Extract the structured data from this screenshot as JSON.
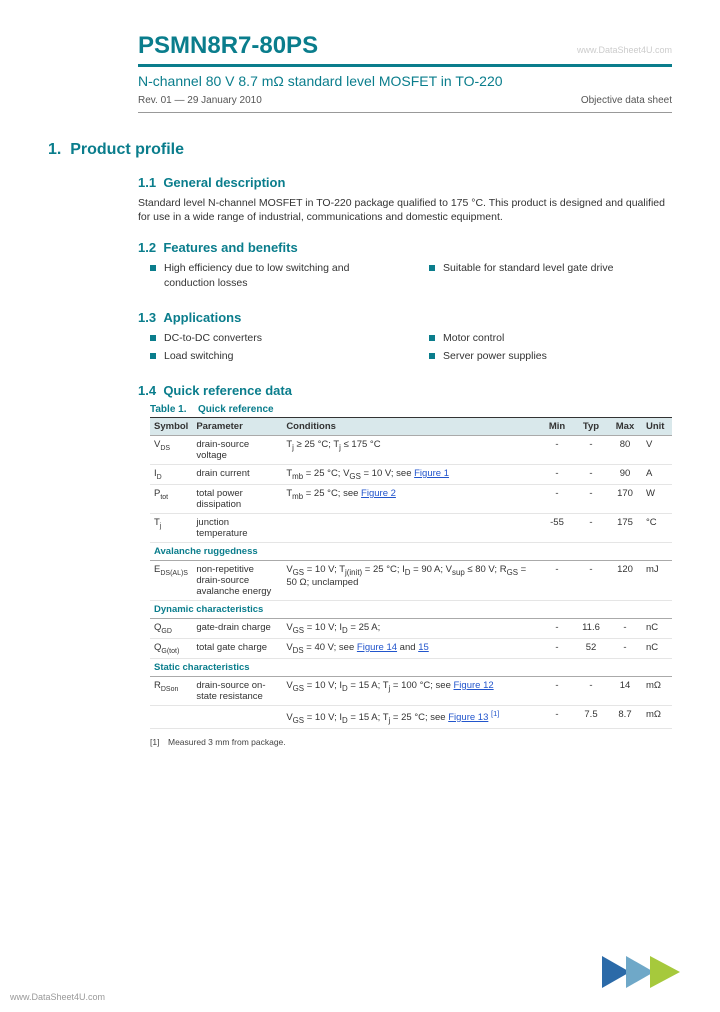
{
  "header": {
    "part_number": "PSMN8R7-80PS",
    "right_faint": "www.DataSheet4U.com",
    "subtitle": "N-channel 80 V 8.7 mΩ standard level MOSFET in TO-220",
    "rev": "Rev. 01 — 29 January 2010",
    "doc_type": "Objective data sheet"
  },
  "s1": {
    "num": "1.",
    "title": "Product profile",
    "s11": {
      "num": "1.1",
      "title": "General description",
      "text": "Standard level N-channel MOSFET in TO-220 package qualified to 175 °C. This product is designed and qualified for use in a wide range of industrial, communications and domestic equipment."
    },
    "s12": {
      "num": "1.2",
      "title": "Features and benefits",
      "left": [
        "High efficiency due to low switching and conduction losses"
      ],
      "right": [
        "Suitable for standard level gate drive"
      ]
    },
    "s13": {
      "num": "1.3",
      "title": "Applications",
      "left": [
        "DC-to-DC converters",
        "Load switching"
      ],
      "right": [
        "Motor control",
        "Server power supplies"
      ]
    },
    "s14": {
      "num": "1.4",
      "title": "Quick reference data"
    }
  },
  "table": {
    "caption_num": "Table 1.",
    "caption": "Quick reference",
    "headers": [
      "Symbol",
      "Parameter",
      "Conditions",
      "Min",
      "Typ",
      "Max",
      "Unit"
    ],
    "rows": [
      {
        "sym": "V<sub>DS</sub>",
        "par": "drain-source voltage",
        "cond": "T<sub>j</sub> ≥ 25 °C; T<sub>j</sub> ≤ 175 °C",
        "min": "-",
        "typ": "-",
        "max": "80",
        "unit": "V"
      },
      {
        "sym": "I<sub>D</sub>",
        "par": "drain current",
        "cond": "T<sub>mb</sub> = 25 °C; V<sub>GS</sub> = 10 V; see <span class='lnk'>Figure 1</span>",
        "min": "-",
        "typ": "-",
        "max": "90",
        "unit": "A"
      },
      {
        "sym": "P<sub>tot</sub>",
        "par": "total power dissipation",
        "cond": "T<sub>mb</sub> = 25 °C; see <span class='lnk'>Figure 2</span>",
        "min": "-",
        "typ": "-",
        "max": "170",
        "unit": "W"
      },
      {
        "sym": "T<sub>j</sub>",
        "par": "junction temperature",
        "cond": "",
        "min": "-55",
        "typ": "-",
        "max": "175",
        "unit": "°C"
      }
    ],
    "sub1": "Avalanche ruggedness",
    "rows2": [
      {
        "sym": "E<sub>DS(AL)S</sub>",
        "par": "non-repetitive drain-source avalanche energy",
        "cond": "V<sub>GS</sub> = 10 V; T<sub>j(init)</sub> = 25 °C; I<sub>D</sub> = 90 A; V<sub>sup</sub> ≤ 80 V; R<sub>GS</sub> = 50 Ω; unclamped",
        "min": "-",
        "typ": "-",
        "max": "120",
        "unit": "mJ"
      }
    ],
    "sub2": "Dynamic characteristics",
    "rows3": [
      {
        "sym": "Q<sub>GD</sub>",
        "par": "gate-drain charge",
        "cond": "V<sub>GS</sub> = 10 V; I<sub>D</sub> = 25 A;",
        "min": "-",
        "typ": "11.6",
        "max": "-",
        "unit": "nC"
      },
      {
        "sym": "Q<sub>G(tot)</sub>",
        "par": "total gate charge",
        "cond": "V<sub>DS</sub> = 40 V; see <span class='lnk'>Figure 14</span> and <span class='lnk'>15</span>",
        "min": "-",
        "typ": "52",
        "max": "-",
        "unit": "nC"
      }
    ],
    "sub3": "Static characteristics",
    "rows4": [
      {
        "sym": "R<sub>DSon</sub>",
        "par": "drain-source on-state resistance",
        "cond": "V<sub>GS</sub> = 10 V; I<sub>D</sub> = 15 A; T<sub>j</sub> = 100 °C; see <span class='lnk'>Figure 12</span>",
        "min": "-",
        "typ": "-",
        "max": "14",
        "unit": "mΩ"
      },
      {
        "sym": "",
        "par": "",
        "cond": "V<sub>GS</sub> = 10 V; I<sub>D</sub> = 15 A; T<sub>j</sub> = 25 °C; see <span class='lnk'>Figure 13</span>",
        "ref": "[1]",
        "min": "-",
        "typ": "7.5",
        "max": "8.7",
        "unit": "mΩ"
      }
    ]
  },
  "footnote": {
    "num": "[1]",
    "text": "Measured 3 mm from package."
  },
  "footer_url": "www.DataSheet4U.com"
}
